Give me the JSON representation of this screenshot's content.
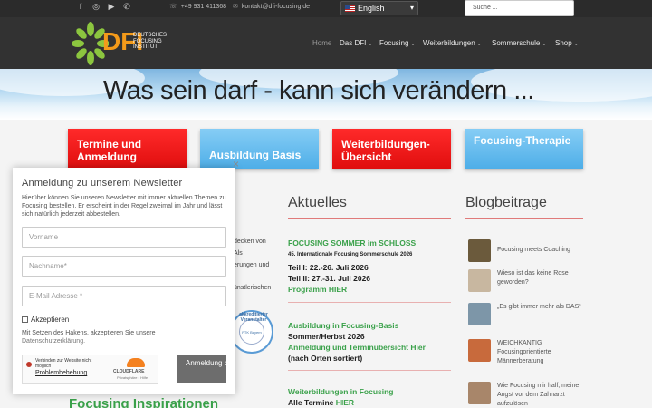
{
  "topbar": {
    "social": [
      {
        "icon": "facebook-icon",
        "glyph": "f"
      },
      {
        "icon": "instagram-icon",
        "glyph": "◎"
      },
      {
        "icon": "youtube-icon",
        "glyph": "▶"
      },
      {
        "icon": "whatsapp-icon",
        "glyph": "✆"
      }
    ],
    "phone": "+49 931 411368",
    "email": "kontakt@dfi-focusing.de",
    "language": "English",
    "search_placeholder": "Suche ..."
  },
  "header": {
    "logo_text": "DFI",
    "logo_sub": [
      "DEUTSCHES",
      "FOCUSING",
      "INSTITUT"
    ],
    "nav": [
      {
        "label": "Home",
        "active": true,
        "dropdown": false
      },
      {
        "label": "Das DFI",
        "dropdown": true
      },
      {
        "label": "Focusing",
        "dropdown": true
      },
      {
        "label": "Weiterbildungen",
        "dropdown": true
      },
      {
        "label": "Sommerschule",
        "dropdown": true
      },
      {
        "label": "Shop",
        "dropdown": true
      }
    ]
  },
  "banner": {
    "title": "Was sein darf - kann sich verändern ..."
  },
  "tiles": [
    {
      "label": "Termine und Anmeldung",
      "color": "#ee1c1c"
    },
    {
      "label": "Ausbildung Basis",
      "color": "#5ab8ee"
    },
    {
      "label": "Weiterbildungen-Übersicht",
      "color": "#ee1c1c"
    },
    {
      "label": "Focusing-Therapie",
      "color": "#5ab8ee"
    }
  ],
  "left_fragments": [
    "decken von",
    "Als",
    "erungen und",
    "ünstlerischen"
  ],
  "seal": {
    "ring_text": "akkreditierter Veranstalter",
    "center": "PTK Bayern"
  },
  "aktuelles": {
    "heading": "Aktuelles",
    "items": [
      {
        "title": "FOCUSING SOMMER im SCHLOSS",
        "subtitle": "45. Internationale Focusing Sommerschule 2026",
        "line1": "Teil I:  22.-26. Juli 2026",
        "line2": "Teil II: 27.-31. Juli 2026",
        "link": "Programm HIER"
      },
      {
        "title": "Ausbildung in Focusing-Basis",
        "line1": "Sommer/Herbst 2026",
        "link": "Anmeldung und Terminübersicht Hier",
        "note": "(nach Orten sortiert)"
      },
      {
        "title": "Weiterbildungen in Focusing",
        "line1_prefix": "Alle Termine ",
        "line1_link": "HIER"
      }
    ]
  },
  "blog": {
    "heading": "Blogbeitrage",
    "items": [
      {
        "title": "Focusing meets Coaching",
        "thumb": "#6b5a3c"
      },
      {
        "title": "Wieso ist das keine Rose geworden?",
        "thumb": "#c8b7a0"
      },
      {
        "title": "„Es gibt immer mehr als DAS“",
        "thumb": "#7d96a8"
      },
      {
        "title": "WEICHKANTIG Focusingorientierte Männerberatung",
        "thumb": "#c86a3c"
      },
      {
        "title": "Wie Focusing mir half, meine Angst vor dem Zahnarzt aufzulösen",
        "thumb": "#a8866a"
      }
    ]
  },
  "inspirationen": "Focusing Inspirationen",
  "popup": {
    "close": "×",
    "title": "Anmeldung zu unserem Newsletter",
    "description": "Hierüber können Sie unseren Newsletter mit immer aktuellen Themen zu Focusing bestellen. Er erscheint in der Regel zweimal im Jahr und lässt sich natürlich jederzeit abbestellen.",
    "fields": {
      "vorname": "Vorname",
      "nachname": "Nachname*",
      "email": "E-Mail Adresse *"
    },
    "checkbox_label": "Akzeptieren",
    "consent_text": "Mit Setzen des Hakens, akzeptieren Sie unsere",
    "consent_link": "Datenschutzerklärung.",
    "captcha": {
      "message": "Verbinden zur Website nicht möglich",
      "link": "Problembehebung",
      "brand": "CLOUDFLARE",
      "links": "Privatsphäre • Hilfe"
    },
    "submit": "Anmeldung bestätigen"
  }
}
